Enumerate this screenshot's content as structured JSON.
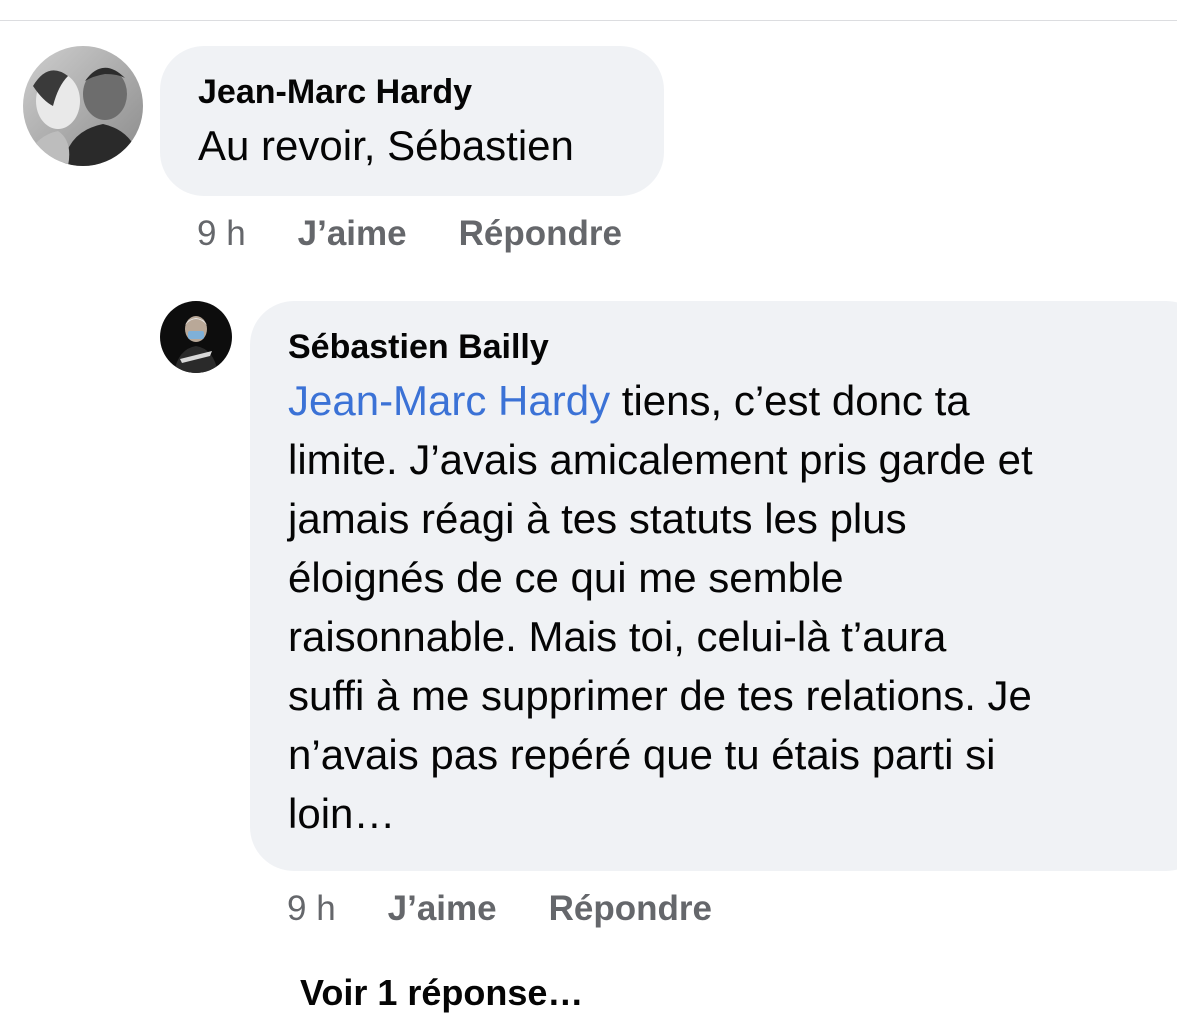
{
  "comments": [
    {
      "author": "Jean-Marc Hardy",
      "text": "Au revoir, Sébastien",
      "time": "9 h",
      "like_label": "J’aime",
      "reply_label": "Répondre"
    },
    {
      "author": "Sébastien Bailly",
      "mention": "Jean-Marc Hardy",
      "lines": [
        " tiens, c’est donc ta",
        "limite. J’avais amicalement pris garde et",
        "jamais réagi à tes statuts les plus",
        "éloignés de ce qui me semble",
        "raisonnable. Mais toi, celui-là t’aura",
        "suffi à me supprimer de tes relations. Je",
        "n’avais pas repéré que tu étais parti si",
        "loin…"
      ],
      "time": "9 h",
      "like_label": "J’aime",
      "reply_label": "Répondre"
    }
  ],
  "view_replies_label": "Voir 1 réponse…",
  "colors": {
    "bubble_bg": "#f0f2f5",
    "mention": "#3b72d6",
    "meta": "#65676b",
    "text": "#050505"
  }
}
